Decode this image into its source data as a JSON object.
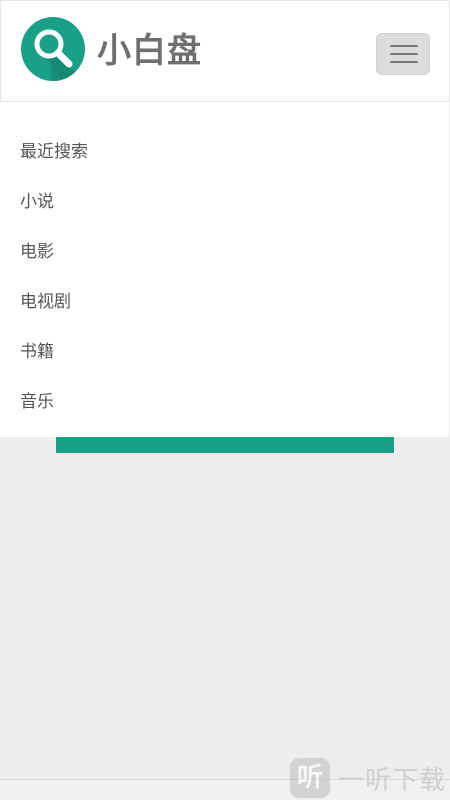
{
  "header": {
    "brand": "小白盘",
    "logo_icon": "search-icon",
    "menu_icon": "hamburger-icon"
  },
  "menu": {
    "items": [
      {
        "label": "最近搜索"
      },
      {
        "label": "小说"
      },
      {
        "label": "电影"
      },
      {
        "label": "电视剧"
      },
      {
        "label": "书籍"
      },
      {
        "label": "音乐"
      }
    ]
  },
  "watermark": {
    "icon_glyph": "听",
    "text": "一听下载"
  },
  "colors": {
    "accent": "#1aa087",
    "text": "#555555",
    "background": "#ededed"
  }
}
